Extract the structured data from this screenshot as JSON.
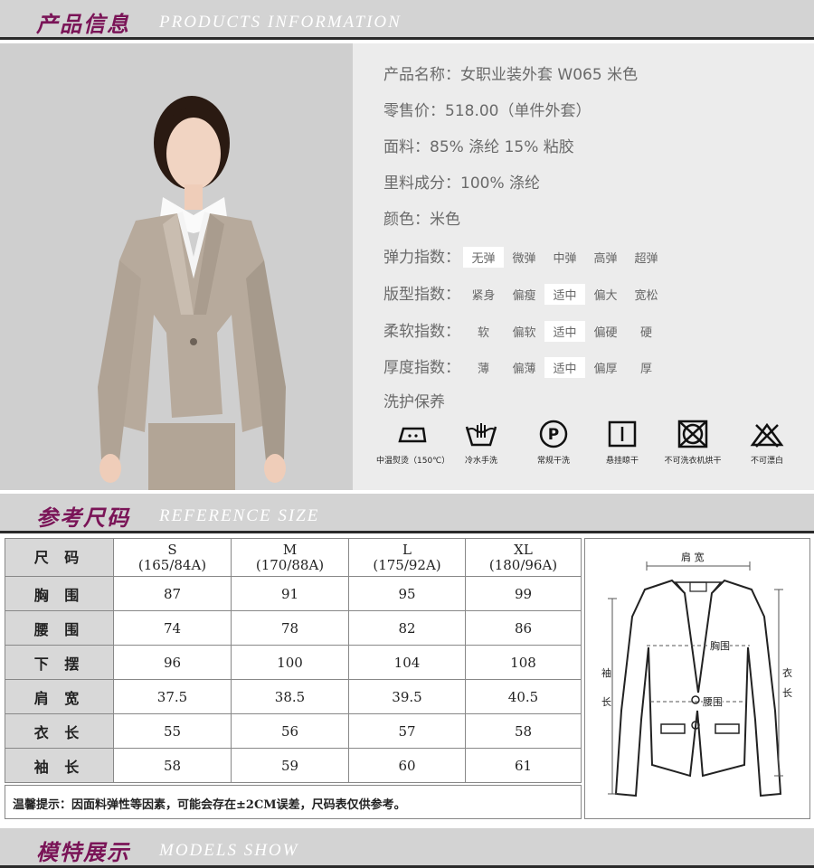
{
  "sections": {
    "products": {
      "cn": "产品信息",
      "en": "PRODUCTS INFORMATION"
    },
    "size": {
      "cn": "参考尺码",
      "en": "REFERENCE SIZE"
    },
    "models": {
      "cn": "模特展示",
      "en": "MODELS SHOW"
    }
  },
  "product": {
    "name": "产品名称：女职业装外套 W065 米色",
    "price": "零售价：518.00（单件外套）",
    "fabric": "面料：85% 涤纶 15% 粘胶",
    "lining": "里料成分：100% 涤纶",
    "color": "颜色：米色"
  },
  "scales": [
    {
      "label": "弹力指数：",
      "options": [
        "无弹",
        "微弹",
        "中弹",
        "高弹",
        "超弹"
      ],
      "selected": 0
    },
    {
      "label": "版型指数：",
      "options": [
        "紧身",
        "偏瘦",
        "适中",
        "偏大",
        "宽松"
      ],
      "selected": 2
    },
    {
      "label": "柔软指数：",
      "options": [
        "软",
        "偏软",
        "适中",
        "偏硬",
        "硬"
      ],
      "selected": 2
    },
    {
      "label": "厚度指数：",
      "options": [
        "薄",
        "偏薄",
        "适中",
        "偏厚",
        "厚"
      ],
      "selected": 2
    }
  ],
  "care": {
    "title": "洗护保养",
    "items": [
      {
        "icon": "iron-icon",
        "label": "中温熨烫（150℃）"
      },
      {
        "icon": "hand-wash-icon",
        "label": "冷水手洗"
      },
      {
        "icon": "dry-clean-icon",
        "label": "常规干洗"
      },
      {
        "icon": "hang-dry-icon",
        "label": "悬挂晾干"
      },
      {
        "icon": "no-tumble-dry-icon",
        "label": "不可洗衣机烘干"
      },
      {
        "icon": "no-bleach-icon",
        "label": "不可漂白"
      }
    ]
  },
  "size_table": {
    "header": {
      "label": "尺 码",
      "sizes": [
        {
          "size": "S",
          "spec": "(165/84A)"
        },
        {
          "size": "M",
          "spec": "(170/88A)"
        },
        {
          "size": "L",
          "spec": "(175/92A)"
        },
        {
          "size": "XL",
          "spec": "(180/96A)"
        }
      ]
    },
    "rows": [
      {
        "label": "胸 围",
        "values": [
          "87",
          "91",
          "95",
          "99"
        ]
      },
      {
        "label": "腰 围",
        "values": [
          "74",
          "78",
          "82",
          "86"
        ]
      },
      {
        "label": "下 摆",
        "values": [
          "96",
          "100",
          "104",
          "108"
        ]
      },
      {
        "label": "肩 宽",
        "values": [
          "37.5",
          "38.5",
          "39.5",
          "40.5"
        ]
      },
      {
        "label": "衣 长",
        "values": [
          "55",
          "56",
          "57",
          "58"
        ]
      },
      {
        "label": "袖 长",
        "values": [
          "58",
          "59",
          "60",
          "61"
        ]
      }
    ],
    "note": "温馨提示：因面料弹性等因素，可能会存在±2CM误差，尺码表仅供参考。"
  },
  "diagram": {
    "shoulder": "肩 宽",
    "chest": "胸围",
    "waist": "腰围",
    "sleeve_a": "袖",
    "sleeve_b": "长",
    "length_a": "衣",
    "length_b": "长"
  }
}
